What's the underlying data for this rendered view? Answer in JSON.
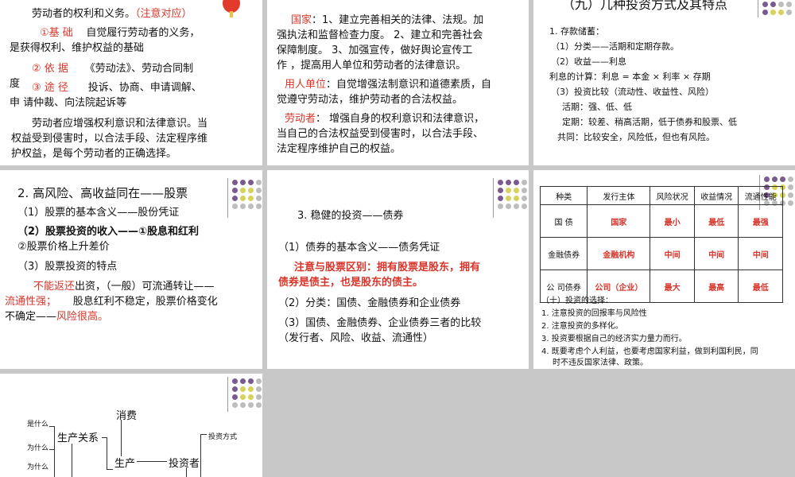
{
  "slide1": {
    "line1": "劳动者的权利和义务。",
    "line1_note": "（注意对应）",
    "basis_label": "①基 础",
    "basis_text": "自觉履行劳动者的义务，",
    "basis_text2": "是获得权利、维护权益的基础",
    "law_label": "② 依 据",
    "law_text": "《劳动法》、劳动合同制",
    "law_text2": "度",
    "way_label": "③ 途 径",
    "way_text": "投诉、协商、申请调解、",
    "way_text2": "申 请仲裁、向法院起诉等",
    "p1": "劳动者应增强权利意识和法律意识。当",
    "p2": "权益受到侵害时，以合法手段、法定程序维",
    "p3": "护权益，是每个劳动者的正确选择。"
  },
  "slide2": {
    "state_label": "国家",
    "state_text": "：1、建立完善相关的法律、法规。加",
    "l2": "强执法和监督检查力度。 2、建立和完善社会",
    "l3": "保障制度。 3、加强宣传，做好舆论宣传工",
    "l4": "作 ，提高用人单位和劳动者的法律意识。",
    "emp_label": "用人单位",
    "emp_text": "：自觉增强法制意识和道德素质，自",
    "l6": "觉遵守劳动法，维护劳动者的合法权益。",
    "worker_label": "劳动者",
    "worker_text": "： 增强自身的权利意识和法律意识，",
    "l8": "当自己的合法权益受到侵害时，以合法手段、",
    "l9": "法定程序维护自己的权益。"
  },
  "slide3": {
    "title": "（九）几种投资方式及其特点",
    "l1": "1. 存款储蓄：",
    "l2": "（1）分类——活期和定期存款。",
    "l3": "（2）收益——利息",
    "l4": "利息的计算：利息 = 本金 × 利率 × 存期",
    "l5": "（3）投资比较（流动性、收益性、风险）",
    "l6": "活期：强、低、低",
    "l7": "定期：较差、稍高活期，低于债券和股票、低",
    "l8": "共同：比较安全，风险低，但也有风险。"
  },
  "slide4": {
    "title": "2. 高风险、高收益同在——股票",
    "l1": "（1）股票的基本含义——股份凭证",
    "l2": "（2）股票投资的收入——①股息和红利",
    "l3": "②股票价格上升差价",
    "l4": "（3）股票投资的特点",
    "l5a": "不能返还",
    "l5b": "出资，（一般）可流通转让——",
    "l6a": "流通性强；",
    "l6b": "股息红利不稳定，股票价格变化",
    "l7a": "不确定——",
    "l7b": "风险很高。"
  },
  "slide5": {
    "title": "3. 稳健的投资——债券",
    "l1": "（1）债券的基本含义——债务凭证",
    "l2": "注意与股票区别：拥有股票是股东，拥有",
    "l3": "债券是债主，也是股东的债主。",
    "l4": "（2）分类：国债、金融债券和企业债券",
    "l5": "（3）国债、金融债券、企业债券三者的比较",
    "l6": "（发行者、风险、收益、流通性）"
  },
  "slide6": {
    "headers": [
      "种类",
      "发行主体",
      "风险状况",
      "收益情况",
      "流通性能"
    ],
    "rows": [
      [
        "国 债",
        "国家",
        "最小",
        "最低",
        "最强"
      ],
      [
        "金融债券",
        "金融机构",
        "中间",
        "中间",
        "中间"
      ],
      [
        "公 司债券",
        "公司（企业）",
        "最大",
        "最高",
        "最低"
      ]
    ],
    "n0": "（十）投资的选择：",
    "n1": "1. 注意投资的回报率与风险性",
    "n2": "2. 注意投资的多样化。",
    "n3": "3. 投资要根据自己的经济实力量力而行。",
    "n4": "4. 既要考虑个人利益，也要考虑国家利益，做到利国利民，同",
    "n5": "时不违反国家法律、政策。"
  },
  "slide7": {
    "consume": "消费",
    "relation": "生产关系",
    "produce": "生产",
    "investor": "投资者",
    "what1": "是什么",
    "why1": "为什么",
    "why2": "为什么",
    "invest_way": "投资方式"
  }
}
